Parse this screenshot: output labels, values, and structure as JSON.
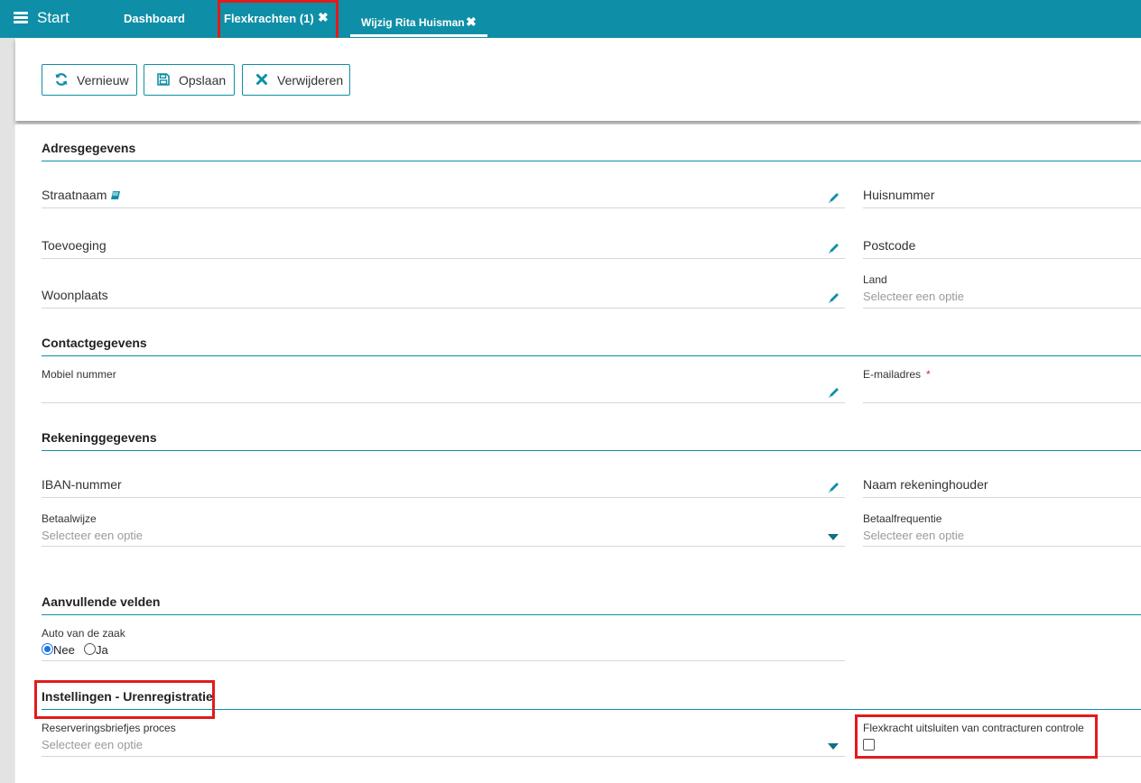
{
  "topbar": {
    "menu_label": "Start",
    "tabs": [
      {
        "label": "Dashboard"
      },
      {
        "label": "Flexkrachten (1)"
      },
      {
        "label": "Wijzig Rita Huisman"
      }
    ],
    "close_glyph": "✖"
  },
  "toolbar": {
    "refresh_label": "Vernieuw",
    "save_label": "Opslaan",
    "delete_label": "Verwijderen"
  },
  "sections": {
    "adres": {
      "title": "Adresgegevens",
      "straatnaam": "Straatnaam",
      "huisnummer": "Huisnummer",
      "toevoeging": "Toevoeging",
      "postcode": "Postcode",
      "woonplaats": "Woonplaats",
      "land": "Land",
      "land_placeholder": "Selecteer een optie"
    },
    "contact": {
      "title": "Contactgegevens",
      "mobiel": "Mobiel nummer",
      "email": "E-mailadres",
      "required_mark": "*"
    },
    "rekening": {
      "title": "Rekeninggegevens",
      "iban": "IBAN-nummer",
      "naam_houder": "Naam rekeninghouder",
      "betaalwijze": "Betaalwijze",
      "betaalwijze_placeholder": "Selecteer een optie",
      "betaalfrequentie": "Betaalfrequentie",
      "betaalfrequentie_placeholder": "Selecteer een optie"
    },
    "aanvullend": {
      "title": "Aanvullende velden",
      "auto_label": "Auto van de zaak",
      "option_nee": "Nee",
      "option_ja": "Ja",
      "selected": "Nee"
    },
    "instellingen": {
      "title": "Instellingen - Urenregistratie",
      "reservering_label": "Reserveringsbriefjes proces",
      "reservering_placeholder": "Selecteer een optie",
      "uitsluiten_label": "Flexkracht uitsluiten van contracturen controle",
      "uitsluiten_checked": false
    }
  },
  "colors": {
    "accent": "#0e8fa7",
    "highlight": "#e21b1b",
    "required": "#d9232b"
  }
}
